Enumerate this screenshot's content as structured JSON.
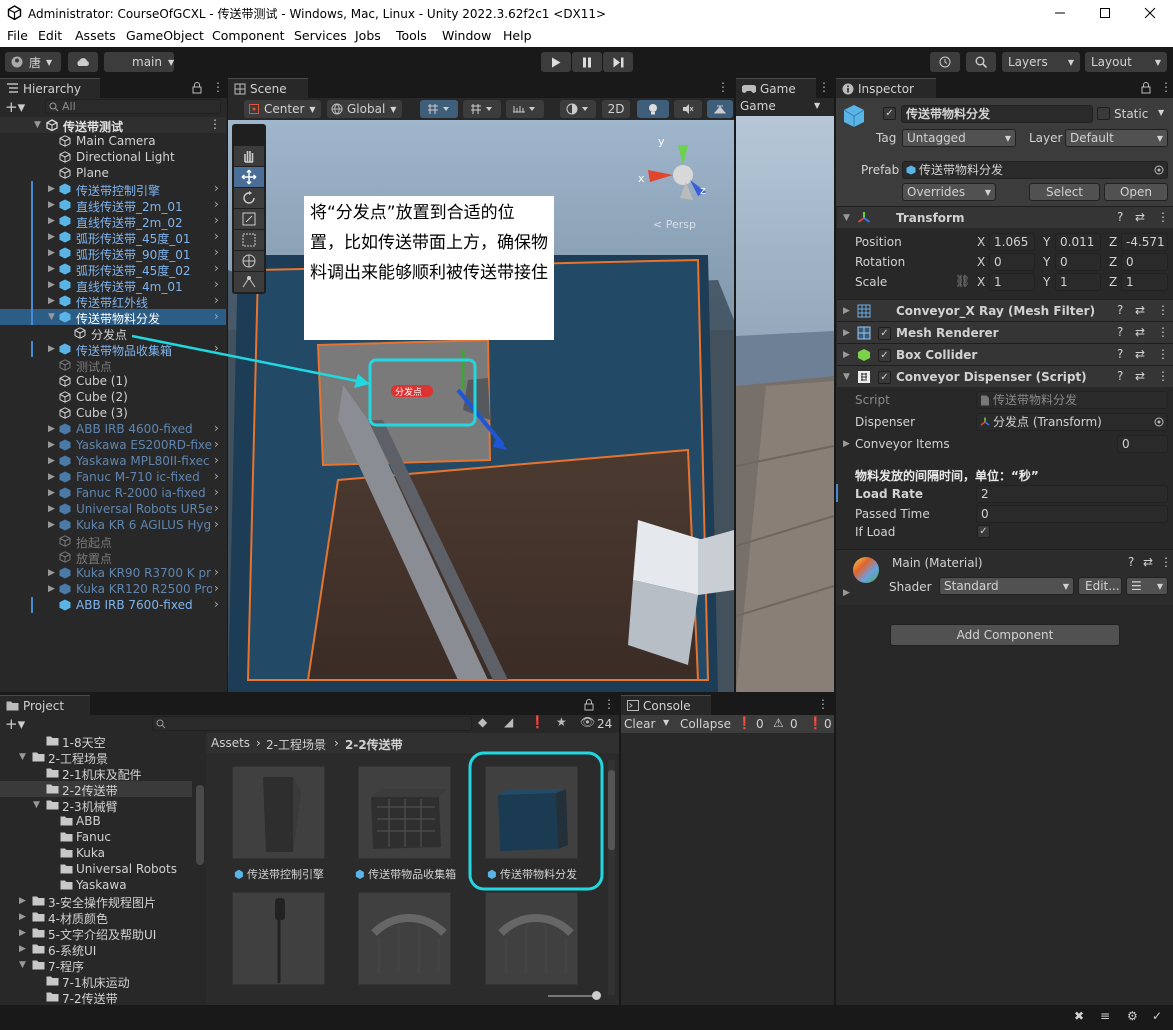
{
  "window": {
    "title": "Administrator: CourseOfGCXL - 传送带测试 - Windows, Mac, Linux - Unity 2022.3.62f2c1 <DX11>"
  },
  "menu": [
    "File",
    "Edit",
    "Assets",
    "GameObject",
    "Component",
    "Services",
    "Jobs",
    "Tools",
    "Window",
    "Help"
  ],
  "toolbar": {
    "account": "唐",
    "branch": "main",
    "layers": "Layers",
    "layout": "Layout"
  },
  "hierarchy": {
    "tab": "Hierarchy",
    "search_placeholder": "All",
    "scene": "传送带测试",
    "items": [
      {
        "label": "Main Camera",
        "style": "normal"
      },
      {
        "label": "Directional Light",
        "style": "normal"
      },
      {
        "label": "Plane",
        "style": "normal"
      },
      {
        "label": "传送带控制引擎",
        "style": "prefab"
      },
      {
        "label": "直线传送带_2m_01",
        "style": "prefab"
      },
      {
        "label": "直线传送带_2m_02",
        "style": "prefab"
      },
      {
        "label": "弧形传送带_45度_01",
        "style": "prefab"
      },
      {
        "label": "弧形传送带_90度_01",
        "style": "prefab"
      },
      {
        "label": "弧形传送带_45度_02",
        "style": "prefab"
      },
      {
        "label": "直线传送带_4m_01",
        "style": "prefab"
      },
      {
        "label": "传送带红外线",
        "style": "prefab"
      },
      {
        "label": "传送带物料分发",
        "style": "selected"
      },
      {
        "label": "分发点",
        "style": "child"
      },
      {
        "label": "传送带物品收集箱",
        "style": "prefab"
      },
      {
        "label": "测试点",
        "style": "disabled"
      },
      {
        "label": "Cube (1)",
        "style": "normal"
      },
      {
        "label": "Cube (2)",
        "style": "normal"
      },
      {
        "label": "Cube (3)",
        "style": "normal"
      },
      {
        "label": "ABB IRB 4600-fixed",
        "style": "prefab-dim"
      },
      {
        "label": "Yaskawa ES200RD-fixe",
        "style": "prefab-dim"
      },
      {
        "label": "Yaskawa MPL80II-fixec",
        "style": "prefab-dim"
      },
      {
        "label": "Fanuc M-710 ic-fixed",
        "style": "prefab-dim"
      },
      {
        "label": "Fanuc R-2000 ia-fixed",
        "style": "prefab-dim"
      },
      {
        "label": "Universal Robots UR5e-",
        "style": "prefab-dim"
      },
      {
        "label": "Kuka KR 6 AGILUS Hygi",
        "style": "prefab-dim"
      },
      {
        "label": "抬起点",
        "style": "disabled"
      },
      {
        "label": "放置点",
        "style": "disabled"
      },
      {
        "label": "Kuka KR90 R3700 K pri",
        "style": "prefab-dim"
      },
      {
        "label": "Kuka KR120 R2500 Pro",
        "style": "prefab-dim"
      },
      {
        "label": "ABB IRB 7600-fixed",
        "style": "prefab"
      }
    ]
  },
  "scene": {
    "tab": "Scene",
    "pivot": "Center",
    "space": "Global",
    "mode2d": "2D",
    "persp": "< Persp",
    "annotation": "将“分发点”放置到合适的位置，比如传送带面上方，确保物料调出来能够顺利被传送带接住",
    "marker_label": "分发点"
  },
  "game": {
    "tab": "Game",
    "display": "Game"
  },
  "inspector": {
    "tab": "Inspector",
    "object_name": "传送带物料分发",
    "static_label": "Static",
    "tag_label": "Tag",
    "tag_value": "Untagged",
    "layer_label": "Layer",
    "layer_value": "Default",
    "prefab_label": "Prefab",
    "prefab_value": "传送带物料分发",
    "overrides": "Overrides",
    "select": "Select",
    "open": "Open",
    "transform": {
      "name": "Transform",
      "position": {
        "label": "Position",
        "x": "1.065",
        "y": "0.011",
        "z": "-4.571"
      },
      "rotation": {
        "label": "Rotation",
        "x": "0",
        "y": "0",
        "z": "0"
      },
      "scale": {
        "label": "Scale",
        "x": "1",
        "y": "1",
        "z": "1"
      }
    },
    "components": [
      "Conveyor_X Ray (Mesh Filter)",
      "Mesh Renderer",
      "Box Collider",
      "Conveyor Dispenser (Script)"
    ],
    "script": {
      "script_label": "Script",
      "script_value": "传送带物料分发",
      "dispenser_label": "Dispenser",
      "dispenser_value": "分发点 (Transform)",
      "items_label": "Conveyor Items",
      "items_value": "0",
      "header": "物料发放的间隔时间，单位：“秒”",
      "load_rate_label": "Load Rate",
      "load_rate_value": "2",
      "passed_label": "Passed Time",
      "passed_value": "0",
      "ifload_label": "If Load",
      "ifload_value": true
    },
    "material": {
      "name": "Main (Material)",
      "shader_label": "Shader",
      "shader_value": "Standard",
      "edit": "Edit..."
    },
    "add_component": "Add Component"
  },
  "project": {
    "tab": "Project",
    "count": "24",
    "tree": [
      {
        "label": "1-8天空",
        "indent": 2
      },
      {
        "label": "2-工程场景",
        "indent": 1,
        "open": true
      },
      {
        "label": "2-1机床及配件",
        "indent": 2
      },
      {
        "label": "2-2传送带",
        "indent": 2,
        "selected": true
      },
      {
        "label": "2-3机械臂",
        "indent": 2,
        "open": true
      },
      {
        "label": "ABB",
        "indent": 3
      },
      {
        "label": "Fanuc",
        "indent": 3
      },
      {
        "label": "Kuka",
        "indent": 3
      },
      {
        "label": "Universal Robots",
        "indent": 3
      },
      {
        "label": "Yaskawa",
        "indent": 3
      },
      {
        "label": "3-安全操作规程图片",
        "indent": 1
      },
      {
        "label": "4-材质颜色",
        "indent": 1,
        "closed": true
      },
      {
        "label": "5-文字介绍及帮助UI",
        "indent": 1
      },
      {
        "label": "6-系统UI",
        "indent": 1
      },
      {
        "label": "7-程序",
        "indent": 1,
        "open": true
      },
      {
        "label": "7-1机床运动",
        "indent": 2
      },
      {
        "label": "7-2传送带",
        "indent": 2
      }
    ],
    "breadcrumb": [
      "Assets",
      "2-工程场景",
      "2-2传送带"
    ],
    "assets": [
      "传送带控制引擎",
      "传送带物品收集箱",
      "传送带物料分发",
      "",
      "",
      ""
    ]
  },
  "console": {
    "tab": "Console",
    "clear": "Clear",
    "collapse": "Collapse",
    "c1": "0",
    "c2": "0",
    "c3": "0"
  }
}
